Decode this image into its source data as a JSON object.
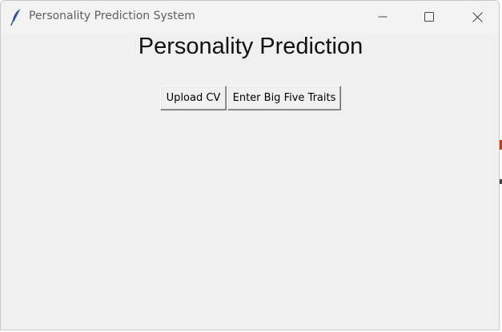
{
  "window": {
    "title": "Personality Prediction System",
    "icon": "feather-icon",
    "controls": [
      "minimize-icon",
      "maximize-icon",
      "close-icon"
    ]
  },
  "main": {
    "heading": "Personality Prediction",
    "buttons": {
      "upload_cv": "Upload CV",
      "big_five": "Enter Big Five Traits"
    }
  },
  "colors": {
    "window_bg": "#f0f0f0",
    "titlebar_bg": "#f3f3f3",
    "title_text": "#5f5f5f",
    "icon_blue": "#2d4f8a"
  }
}
